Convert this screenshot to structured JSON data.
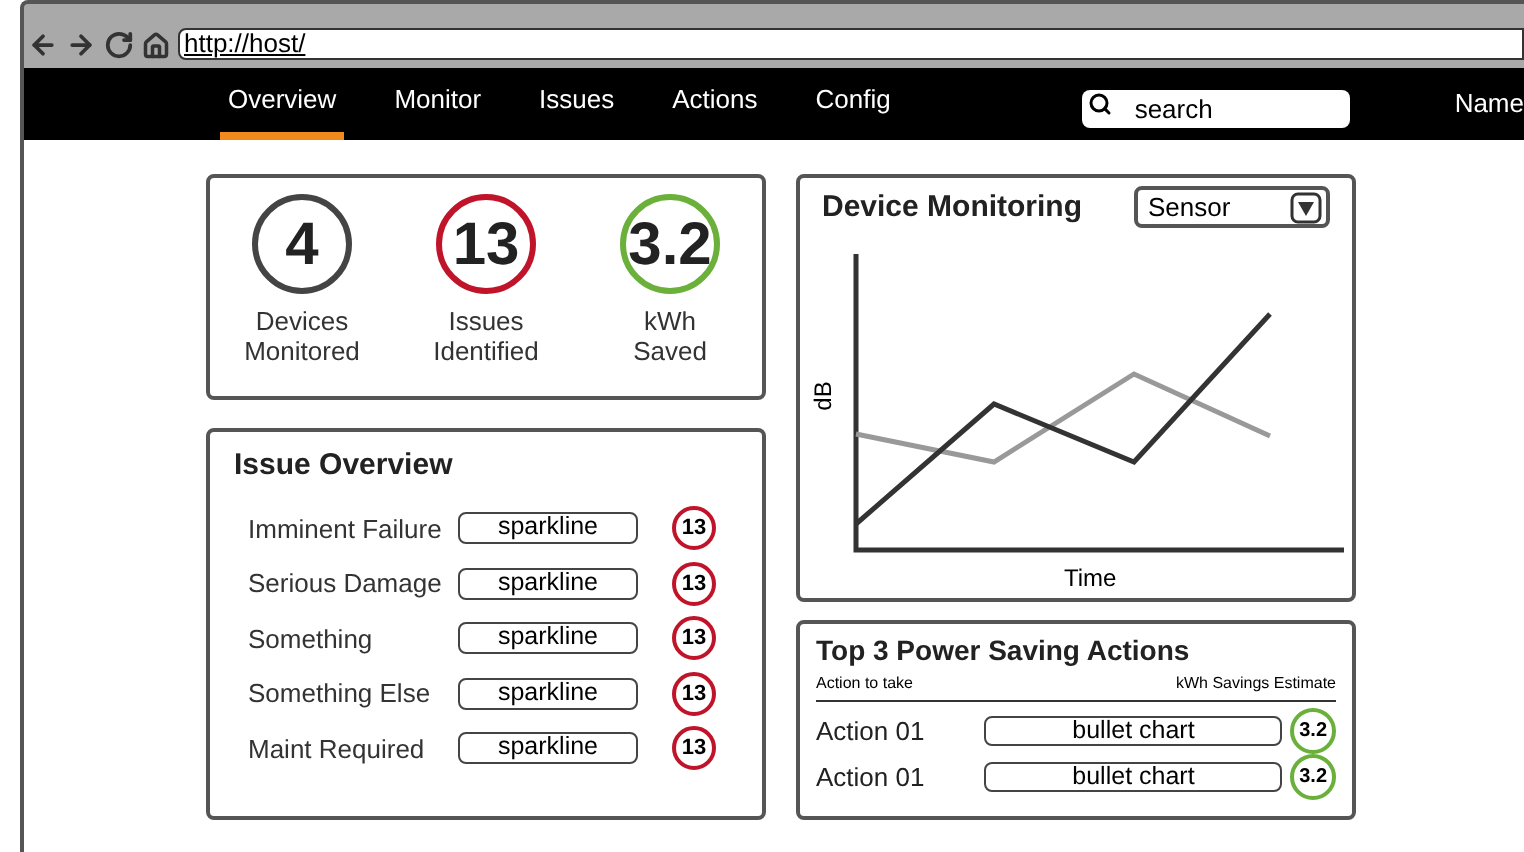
{
  "browser": {
    "url": "http://host/"
  },
  "nav": {
    "tabs": [
      {
        "label": "Overview",
        "selected": true
      },
      {
        "label": "Monitor",
        "selected": false
      },
      {
        "label": "Issues",
        "selected": false
      },
      {
        "label": "Actions",
        "selected": false
      },
      {
        "label": "Config",
        "selected": false
      }
    ],
    "search": {
      "placeholder": "search"
    },
    "user": "Name"
  },
  "stats": [
    {
      "value": "4",
      "label": "Devices Monitored",
      "color": "#444444"
    },
    {
      "value": "13",
      "label": "Issues Identified",
      "color": "#c0142a"
    },
    {
      "value": "3.2",
      "label": "kWh Saved",
      "color": "#6ab03a"
    }
  ],
  "issue_overview": {
    "title": "Issue Overview",
    "rows": [
      {
        "name": "Imminent Failure",
        "chart": "sparkline",
        "count": "13"
      },
      {
        "name": "Serious Damage",
        "chart": "sparkline",
        "count": "13"
      },
      {
        "name": "Something",
        "chart": "sparkline",
        "count": "13"
      },
      {
        "name": "Something Else",
        "chart": "sparkline",
        "count": "13"
      },
      {
        "name": "Maint Required",
        "chart": "sparkline",
        "count": "13"
      }
    ]
  },
  "device_monitoring": {
    "title": "Device Monitoring",
    "dropdown": "Sensor",
    "ylabel": "dB",
    "xlabel": "Time"
  },
  "top_actions": {
    "title": "Top 3 Power Saving Actions",
    "col_left": "Action to take",
    "col_right": "kWh Savings Estimate",
    "rows": [
      {
        "name": "Action 01",
        "chart": "bullet chart",
        "value": "3.2"
      },
      {
        "name": "Action 01",
        "chart": "bullet chart",
        "value": "3.2"
      }
    ]
  }
}
